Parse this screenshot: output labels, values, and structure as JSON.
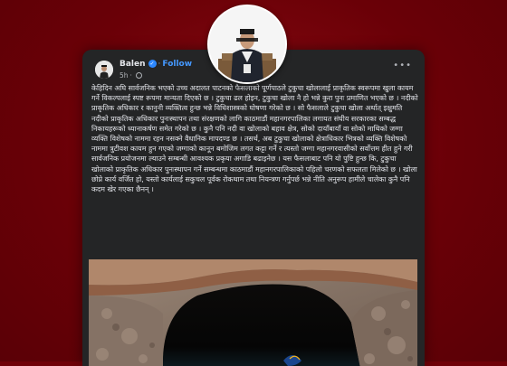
{
  "post": {
    "author": "Balen",
    "follow_label": "Follow",
    "time": "5h",
    "text": "केहिदिन अघि सार्वजनिक भएको उच्च अदालत पाटनको फैसलाको पूर्णपाठले टुकुचा खोलालाई प्राकृतिक स्वरूपमा खुला कायम गर्ने विकल्पलाई स्पष्ट रूपमा मान्यता दिएको छ । टुकुचा ढल होइन, टुकुचा खोला नै हो भन्ने कुरा पुनः प्रमाणित भएको छ । नदीको प्राकृतिक अधिकार र कानुनी व्यक्तित्व हुन्छ भन्ने विधिशास्त्रको घोषणा गरेको छ । सो फैसलाले टुकुचा खोला अर्थात् इक्षुमति नदीको प्राकृतिक अधिकार पुनःस्थापन तथा संरक्षणको लागि काठमाडौं महानगरपालिका लगायत संघीय सरकारका सम्बद्ध निकायहरूको ध्यानाकर्षण समेत गरेको छ । कुनै पनि नदी वा खोलाको बहाव क्षेत्र, सोको दायाँबायाँ वा सोको माथिको जग्गा व्यक्ति विशेषको नाममा रहन नसक्ने वैधानिक मापदण्ड छ । तसर्थ, अब टुकुचा खोलाको क्षेत्राधिकार भित्रको व्यक्ति विशेषको नाममा त्रुटीवश कायम हुन गएको जग्गाको कानून बमोजिम लगत कट्टा गर्ने र त्यस्तो जग्गा महानगरवासीको सर्वोत्तम हीत हुने गरी सार्वजनिक प्रयोजनमा ल्याउने सम्बन्धी आवश्यक प्रकृया अगाडि बढाइनेछ । यस फैसलाबाट पनि यो पुष्टि हुन्छ कि, टुकुचा खोलाको प्राकृतिक अधिकार पुनःस्थापन गर्ने सम्बन्धमा काठमाडौं महानगरपालिकाको पहिलो चरणको सफलता मिलेको छ । खोला छोप्ने कार्य वर्जित हो, यस्तो कार्यलाई सकुचल पूर्वक रोकथाम तथा नियन्त्रण गर्नुपर्छ भन्ने नीति अनुरूप हामीले चालेका कुनै पनि कदम खेर गएका छैनन् ।"
  }
}
